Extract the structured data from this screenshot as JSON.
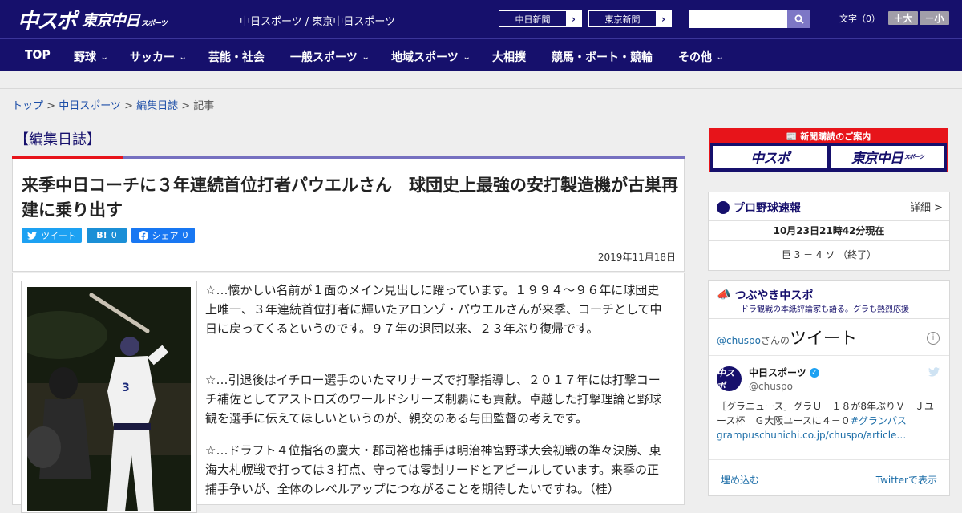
{
  "header": {
    "logo_main": "中スポ",
    "logo_sub": "東京中日",
    "logo_sub_small": "スポーツ",
    "site_title": "中日スポーツ / 東京中日スポーツ",
    "paper_buttons": [
      "中日新聞",
      "東京新聞"
    ],
    "font_label": "文字（0）",
    "font_plus": "＋大",
    "font_minus": "－小"
  },
  "nav": [
    "TOP",
    "野球",
    "サッカー",
    "芸能・社会",
    "一般スポーツ",
    "地域スポーツ",
    "大相撲",
    "競馬・ボート・競輪",
    "その他"
  ],
  "breadcrumb": {
    "items": [
      "トップ",
      "中日スポーツ",
      "編集日誌"
    ],
    "current": "記事",
    "sep": " > "
  },
  "section_title": "【編集日誌】",
  "article": {
    "headline": "来季中日コーチに３年連続首位打者パウエルさん　球団史上最強の安打製造機が古巣再建に乗り出す",
    "share": {
      "tweet": "ツイート",
      "hatena": "B!",
      "hatena_count": "0",
      "facebook": "シェア",
      "facebook_count": "0"
    },
    "date": "2019年11月18日",
    "paragraphs": [
      "☆…懐かしい名前が１面のメイン見出しに躍っています。１９９４～９６年に球団史上唯一、３年連続首位打者に輝いたアロンゾ・パウエルさんが来季、コーチとして中日に戻ってくるというのです。９７年の退団以来、２３年ぶり復帰です。",
      "☆…引退後はイチロー選手のいたマリナーズで打撃指導し、２０１７年には打撃コーチ補佐としてアストロズのワールドシリーズ制覇にも貢献。卓越した打撃理論と野球観を選手に伝えてほしいというのが、親交のある与田監督の考えです。",
      "☆…ドラフト４位指名の慶大・郡司裕也捕手は明治神宮野球大会初戦の準々決勝、東海大札幌戦で打っては３打点、守っては零封リードとアピールしています。来季の正捕手争いが、全体のレベルアップにつながることを期待したいです"
    ],
    "para_tail": "ね。（桂）"
  },
  "sidebar": {
    "ad_caption": "新聞購読のご案内",
    "ad_button_1": "中スポ",
    "ad_button_2": "東京中日",
    "ad_button_2_small": "スポーツ",
    "baseball": {
      "title": "プロ野球速報",
      "more": "詳細 >",
      "timestamp": "10月23日21時42分現在",
      "score": "巨 3 － 4 ソ （終了）"
    },
    "tweets": {
      "title": "つぶやき中スポ",
      "subtitle": "ドラ観戦の本紙評論家も語る。グラも熱烈応援",
      "handle_link": "@chuspo",
      "handle_suffix": "さんの",
      "heading": "ツイート",
      "account_name": "中日スポーツ",
      "account_handle": "@chuspo",
      "avatar_text": "中スポ",
      "tweet_text": "［グラニュース］グラＵ－１８が8年ぶりＶ　Ｊユース杯　Ｇ大阪ユースに４－０",
      "tweet_hashtag": "#グランパス",
      "tweet_url": "grampuschunichi.co.jp/chuspo/article…",
      "embed": "埋め込む",
      "view": "Twitterで表示"
    }
  },
  "colors": {
    "navy": "#16106c",
    "red": "#e7141a",
    "purple_bar": "#7670c0",
    "link": "#1d4fa8"
  }
}
